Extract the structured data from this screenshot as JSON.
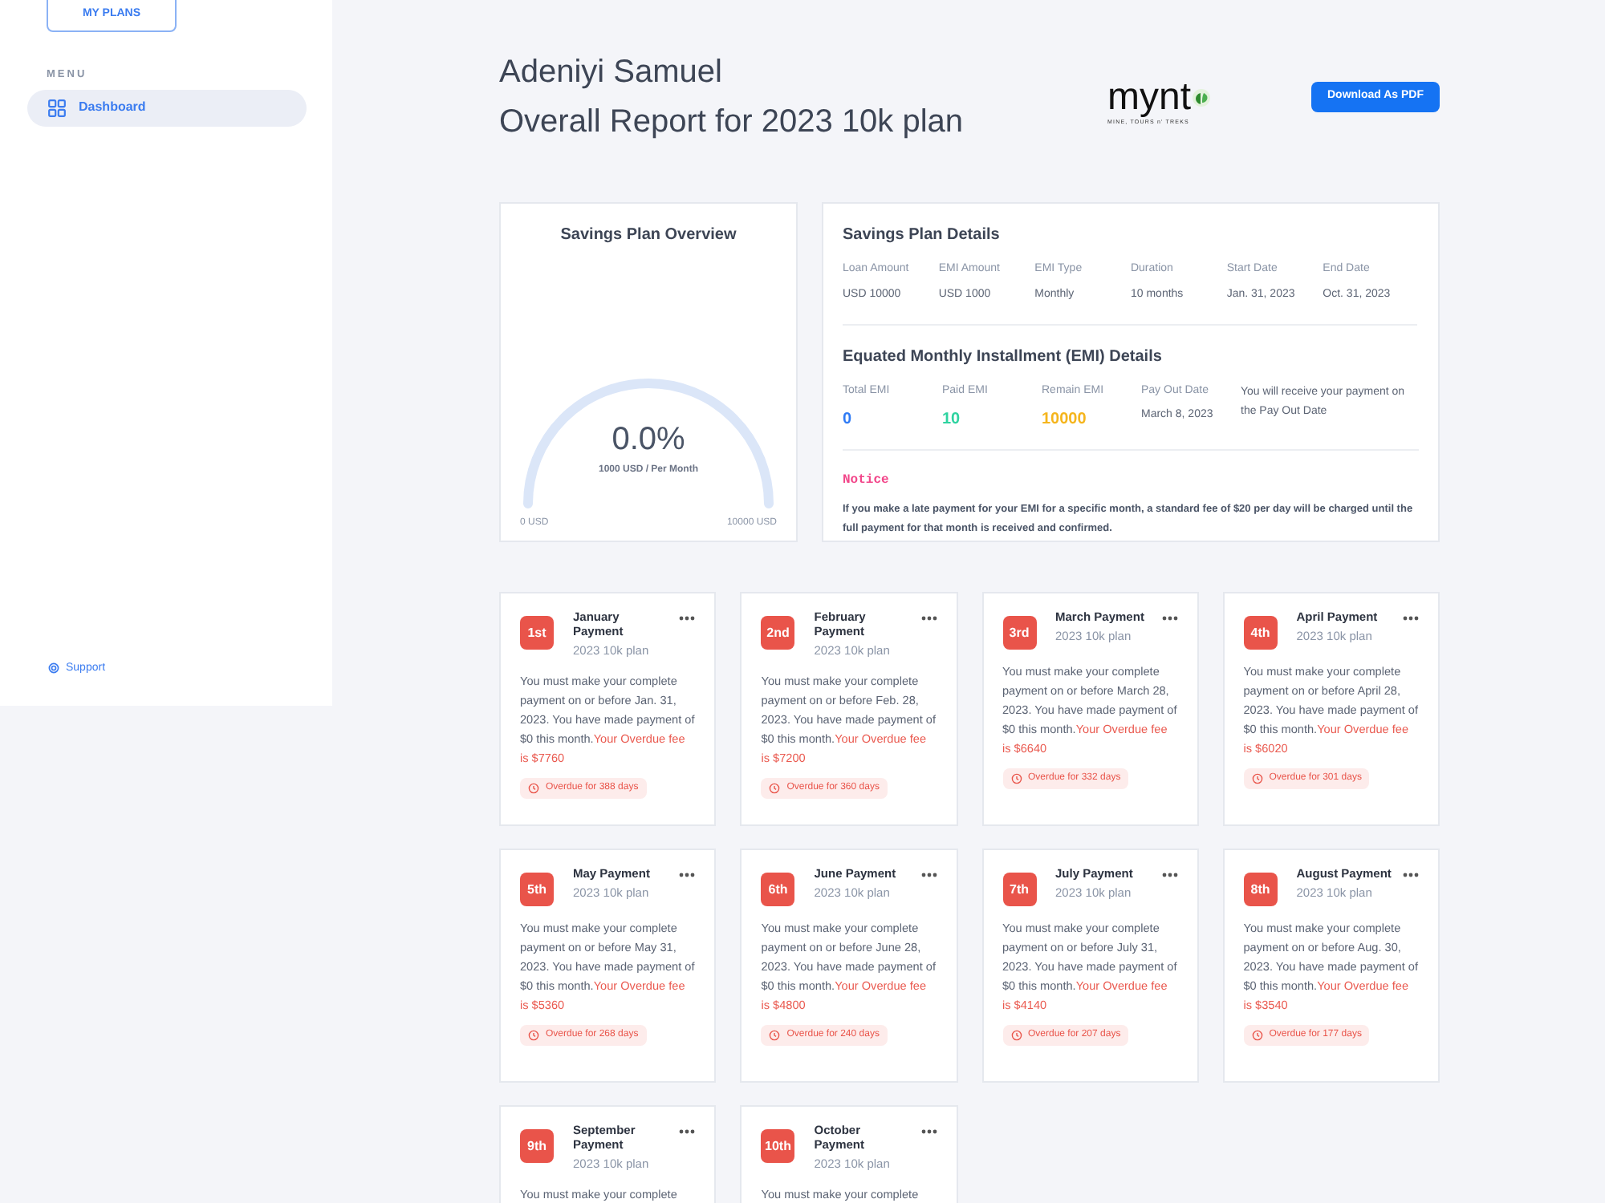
{
  "sidebar": {
    "plans_button": "MY PLANS",
    "menu_label": "MENU",
    "items": [
      {
        "label": "Dashboard",
        "selected": true
      }
    ],
    "support": "Support"
  },
  "header": {
    "name": "Adeniyi Samuel",
    "subtitle": "Overall Report for 2023 10k plan",
    "logo": {
      "wordmark": "mynt",
      "tagline": "MINE, TOURS n' TREKS"
    },
    "download_button": "Download As PDF"
  },
  "overview": {
    "title": "Savings Plan Overview",
    "percent": "0.0%",
    "rate": "1000 USD / Per Month",
    "min": "0 USD",
    "max": "10000 USD"
  },
  "details": {
    "title": "Savings Plan Details",
    "fields": [
      {
        "label": "Loan Amount",
        "value": "USD 10000"
      },
      {
        "label": "EMI Amount",
        "value": "USD 1000"
      },
      {
        "label": "EMI Type",
        "value": "Monthly"
      },
      {
        "label": "Duration",
        "value": "10 months"
      },
      {
        "label": "Start Date",
        "value": "Jan. 31, 2023"
      },
      {
        "label": "End Date",
        "value": "Oct. 31, 2023"
      }
    ],
    "emi_title": "Equated Monthly Installment (EMI) Details",
    "emi_fields": [
      {
        "label": "Total EMI",
        "value": "0",
        "color": "#2f7bf5"
      },
      {
        "label": "Paid EMI",
        "value": "10",
        "color": "#2ed3a0"
      },
      {
        "label": "Remain EMI",
        "value": "10000",
        "color": "#f5b51d"
      },
      {
        "label": "Pay Out Date",
        "value": "March 8, 2023"
      }
    ],
    "payout_note": "You will receive your payment on the Pay Out Date",
    "notice_title": "Notice",
    "notice": "If you make a late payment for your EMI for a specific month, a standard fee of $20 per day will be charged until the full payment for that month is received and confirmed."
  },
  "payments": [
    {
      "badge": "1st",
      "title": "January Payment",
      "plan": "2023 10k plan",
      "body": "You must make your complete payment on or before Jan. 31, 2023. You have made payment of $0 this month.",
      "fee": "Your Overdue fee is $7760",
      "overdue": "Overdue for 388 days"
    },
    {
      "badge": "2nd",
      "title": "February Payment",
      "plan": "2023 10k plan",
      "body": "You must make your complete payment on or before Feb. 28, 2023. You have made payment of $0 this month.",
      "fee": "Your Overdue fee is $7200",
      "overdue": "Overdue for 360 days"
    },
    {
      "badge": "3rd",
      "title": "March Payment",
      "plan": "2023 10k plan",
      "body": "You must make your complete payment on or before March 28, 2023. You have made payment of $0 this month.",
      "fee": "Your Overdue fee is $6640",
      "overdue": "Overdue for 332 days"
    },
    {
      "badge": "4th",
      "title": "April Payment",
      "plan": "2023 10k plan",
      "body": "You must make your complete payment on or before April 28, 2023. You have made payment of $0 this month.",
      "fee": "Your Overdue fee is $6020",
      "overdue": "Overdue for 301 days"
    },
    {
      "badge": "5th",
      "title": "May Payment",
      "plan": "2023 10k plan",
      "body": "You must make your complete payment on or before May 31, 2023. You have made payment of $0 this month.",
      "fee": "Your Overdue fee is $5360",
      "overdue": "Overdue for 268 days"
    },
    {
      "badge": "6th",
      "title": "June Payment",
      "plan": "2023 10k plan",
      "body": "You must make your complete payment on or before June 28, 2023. You have made payment of $0 this month.",
      "fee": "Your Overdue fee is $4800",
      "overdue": "Overdue for 240 days"
    },
    {
      "badge": "7th",
      "title": "July Payment",
      "plan": "2023 10k plan",
      "body": "You must make your complete payment on or before July 31, 2023. You have made payment of $0 this month.",
      "fee": "Your Overdue fee is $4140",
      "overdue": "Overdue for 207 days"
    },
    {
      "badge": "8th",
      "title": "August Payment",
      "plan": "2023 10k plan",
      "body": "You must make your complete payment on or before Aug. 30, 2023. You have made payment of $0 this month.",
      "fee": "Your Overdue fee is $3540",
      "overdue": "Overdue for 177 days"
    },
    {
      "badge": "9th",
      "title": "September Payment",
      "plan": "2023 10k plan",
      "body": "You must make your complete"
    },
    {
      "badge": "10th",
      "title": "October Payment",
      "plan": "2023 10k plan",
      "body": "You must make your complete"
    }
  ]
}
